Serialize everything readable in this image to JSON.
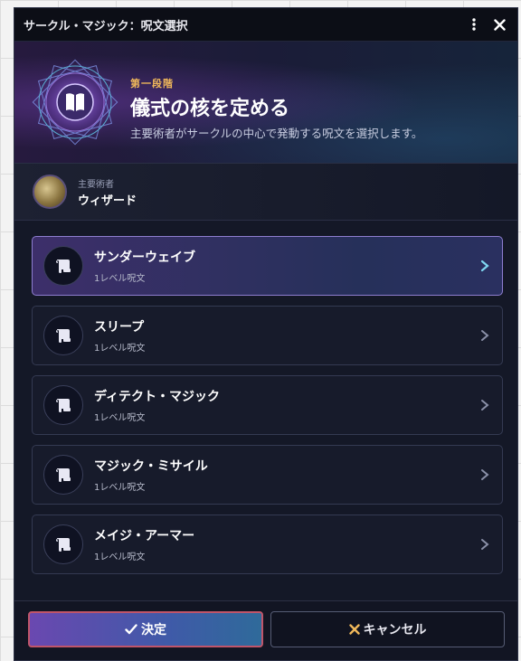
{
  "window": {
    "title": "サークル・マジック：呪文選択"
  },
  "hero": {
    "stage": "第一段階",
    "title": "儀式の核を定める",
    "subtitle": "主要術者がサークルの中心で発動する呪文を選択します。"
  },
  "caster": {
    "label": "主要術者",
    "name": "ウィザード"
  },
  "spells": [
    {
      "name": "サンダーウェイブ",
      "level": "1レベル呪文",
      "selected": true
    },
    {
      "name": "スリープ",
      "level": "1レベル呪文",
      "selected": false
    },
    {
      "name": "ディテクト・マジック",
      "level": "1レベル呪文",
      "selected": false
    },
    {
      "name": "マジック・ミサイル",
      "level": "1レベル呪文",
      "selected": false
    },
    {
      "name": "メイジ・アーマー",
      "level": "1レベル呪文",
      "selected": false
    }
  ],
  "footer": {
    "confirm_label": "決定",
    "cancel_label": "キャンセル"
  },
  "icons": {
    "menu": "kebab-menu-icon",
    "close": "close-icon",
    "sigil": "book-sigil-icon",
    "spell": "scroll-icon",
    "chevron": "chevron-right-icon",
    "confirm": "checkmark-icon",
    "cancel": "x-icon"
  },
  "colors": {
    "accent": "#f0b85a",
    "selected_chevron": "#7fd6f0",
    "cancel_x": "#f0b85a"
  }
}
